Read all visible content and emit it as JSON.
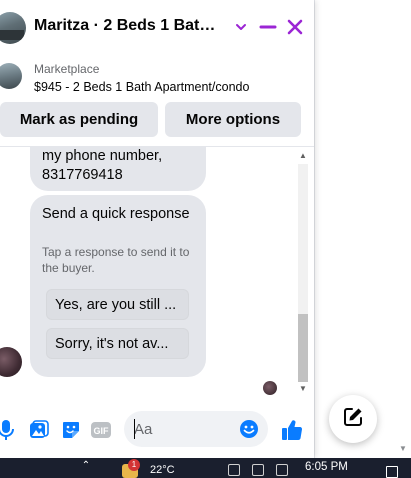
{
  "colors": {
    "accent": "#9b25d4",
    "messenger_blue": "#0a7cff",
    "bubble_gray": "#e4e6eb",
    "taskbar": "#1a1f2e"
  },
  "chat": {
    "header": {
      "title": "Maritza · 2 Beds 1 Bath Ap...",
      "icons": [
        "chevron-down-icon",
        "minimize-icon",
        "close-icon"
      ]
    },
    "listing": {
      "source": "Marketplace",
      "title": "$945 - 2 Beds 1 Bath Apartment/condo"
    },
    "actions": {
      "mark_pending": "Mark as pending",
      "more_options": "More options"
    },
    "messages": [
      {
        "text": "my phone number, 8317769418"
      }
    ],
    "quick_response": {
      "title": "Send a quick response",
      "hint": "Tap a response to send it to the buyer.",
      "options": [
        "Yes, are you still ...",
        "Sorry, it's not av..."
      ]
    },
    "composer": {
      "placeholder": "Aa",
      "icons": [
        "microphone-icon",
        "photo-icon",
        "sticker-icon",
        "gif-icon",
        "emoji-icon",
        "thumbs-up-icon"
      ]
    }
  },
  "new_message_button": {
    "icon": "compose-icon"
  },
  "taskbar": {
    "weather_badge": "1",
    "weather_temp": "22°C",
    "time": "6:05 PM"
  }
}
